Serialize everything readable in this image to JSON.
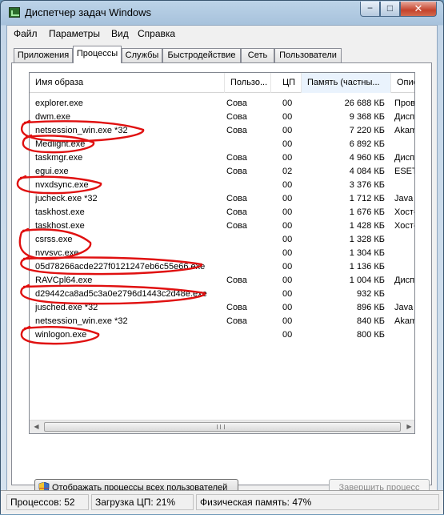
{
  "window": {
    "title": "Диспетчер задач Windows",
    "controls": {
      "minimize": "−",
      "maximize": "□",
      "close": "✕"
    }
  },
  "menu": [
    "Файл",
    "Параметры",
    "Вид",
    "Справка"
  ],
  "tabs": [
    "Приложения",
    "Процессы",
    "Службы",
    "Быстродействие",
    "Сеть",
    "Пользователи"
  ],
  "active_tab": "Процессы",
  "table": {
    "columns": [
      "Имя образа",
      "Пользо...",
      "ЦП",
      "Память (частны...",
      "Описан"
    ],
    "sorted_column": "Память (частны...",
    "rows": [
      {
        "name": "explorer.exe",
        "user": "Сова",
        "cpu": "00",
        "mem": "26 688 КБ",
        "desc": "Провод"
      },
      {
        "name": "dwm.exe",
        "user": "Сова",
        "cpu": "00",
        "mem": "9 368 КБ",
        "desc": "Диспет"
      },
      {
        "name": "netsession_win.exe *32",
        "user": "Сова",
        "cpu": "00",
        "mem": "7 220 КБ",
        "desc": "Akamai"
      },
      {
        "name": "Medlight.exe",
        "user": "",
        "cpu": "00",
        "mem": "6 892 КБ",
        "desc": ""
      },
      {
        "name": "taskmgr.exe",
        "user": "Сова",
        "cpu": "00",
        "mem": "4 960 КБ",
        "desc": "Диспет"
      },
      {
        "name": "egui.exe",
        "user": "Сова",
        "cpu": "02",
        "mem": "4 084 КБ",
        "desc": "ESET GI"
      },
      {
        "name": "nvxdsync.exe",
        "user": "",
        "cpu": "00",
        "mem": "3 376 КБ",
        "desc": ""
      },
      {
        "name": "jucheck.exe *32",
        "user": "Сова",
        "cpu": "00",
        "mem": "1 712 КБ",
        "desc": "Java Up"
      },
      {
        "name": "taskhost.exe",
        "user": "Сова",
        "cpu": "00",
        "mem": "1 676 КБ",
        "desc": "Хост-пр"
      },
      {
        "name": "taskhost.exe",
        "user": "Сова",
        "cpu": "00",
        "mem": "1 428 КБ",
        "desc": "Хост-пр"
      },
      {
        "name": "csrss.exe",
        "user": "",
        "cpu": "00",
        "mem": "1 328 КБ",
        "desc": ""
      },
      {
        "name": "nvvsvc.exe",
        "user": "",
        "cpu": "00",
        "mem": "1 304 КБ",
        "desc": ""
      },
      {
        "name": "05d78266acde227f0121247eb6c55e66.exe",
        "user": "",
        "cpu": "00",
        "mem": "1 136 КБ",
        "desc": ""
      },
      {
        "name": "RAVCpl64.exe",
        "user": "Сова",
        "cpu": "00",
        "mem": "1 004 КБ",
        "desc": "Диспет"
      },
      {
        "name": "d29442ca8ad5c3a0e2796d1443c2d48e.exe",
        "user": "",
        "cpu": "00",
        "mem": "932 КБ",
        "desc": ""
      },
      {
        "name": "jusched.exe *32",
        "user": "Сова",
        "cpu": "00",
        "mem": "896 КБ",
        "desc": "Java Up"
      },
      {
        "name": "netsession_win.exe *32",
        "user": "Сова",
        "cpu": "00",
        "mem": "840 КБ",
        "desc": "Akamai"
      },
      {
        "name": "winlogon.exe",
        "user": "",
        "cpu": "00",
        "mem": "800 КБ",
        "desc": ""
      }
    ]
  },
  "buttons": {
    "show_all": "Отображать процессы всех пользователей",
    "end_process": "Завершить процесс"
  },
  "status": {
    "processes": "Процессов: 52",
    "cpu": "Загрузка ЦП: 21%",
    "memory": "Физическая память: 47%"
  },
  "annotation_color": "#e01010"
}
